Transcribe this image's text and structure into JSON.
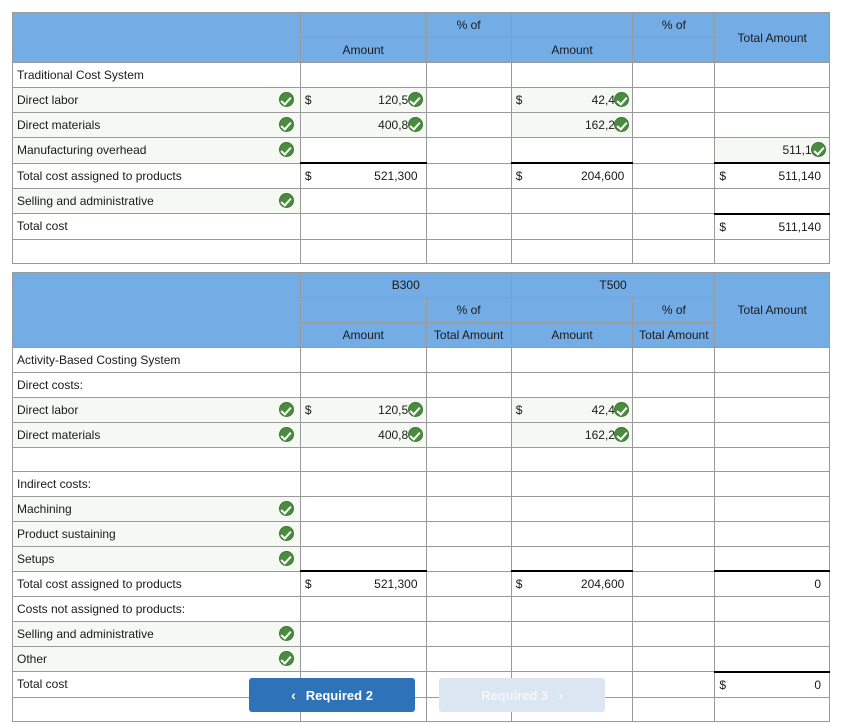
{
  "table1": {
    "header_rows": [
      [
        "",
        "",
        "% of",
        "",
        "% of",
        "Total Amount"
      ],
      [
        "",
        "Amount",
        "",
        "Amount",
        "",
        ""
      ]
    ],
    "rows": [
      {
        "label": "Traditional Cost System",
        "indent": false,
        "label_check": false,
        "cells": [
          {
            "v": ""
          },
          {
            "v": ""
          },
          {
            "v": ""
          },
          {
            "v": ""
          },
          {
            "v": ""
          }
        ]
      },
      {
        "label": "Direct labor",
        "indent": false,
        "label_check": true,
        "cells": [
          {
            "v": "120,500",
            "dollar": true,
            "check": true
          },
          {
            "v": ""
          },
          {
            "v": "42,400",
            "dollar": true,
            "check": true
          },
          {
            "v": ""
          },
          {
            "v": ""
          }
        ]
      },
      {
        "label": "Direct materials",
        "indent": false,
        "label_check": true,
        "cells": [
          {
            "v": "400,800",
            "check": true
          },
          {
            "v": ""
          },
          {
            "v": "162,200",
            "check": true
          },
          {
            "v": ""
          },
          {
            "v": ""
          }
        ]
      },
      {
        "label": "Manufacturing overhead",
        "indent": false,
        "label_check": true,
        "cells": [
          {
            "v": ""
          },
          {
            "v": ""
          },
          {
            "v": ""
          },
          {
            "v": ""
          },
          {
            "v": "511,140",
            "check": true
          }
        ]
      },
      {
        "label": "Total cost assigned to products",
        "indent": false,
        "label_check": false,
        "cells": [
          {
            "v": "521,300",
            "dollar": true,
            "rule": "total"
          },
          {
            "v": ""
          },
          {
            "v": "204,600",
            "dollar": true,
            "rule": "total"
          },
          {
            "v": ""
          },
          {
            "v": "511,140",
            "dollar": true,
            "rule": "total"
          }
        ]
      },
      {
        "label": "Selling and administrative",
        "indent": false,
        "label_check": true,
        "cells": [
          {
            "v": ""
          },
          {
            "v": ""
          },
          {
            "v": ""
          },
          {
            "v": ""
          },
          {
            "v": ""
          }
        ]
      },
      {
        "label": "Total cost",
        "indent": false,
        "label_check": false,
        "cells": [
          {
            "v": ""
          },
          {
            "v": ""
          },
          {
            "v": ""
          },
          {
            "v": ""
          },
          {
            "v": "511,140",
            "dollar": true,
            "rule": "grand"
          }
        ]
      }
    ]
  },
  "table2": {
    "header_rows": [
      [
        "",
        "B300",
        "",
        "T500",
        "",
        "Total Amount"
      ],
      [
        "",
        "",
        "% of",
        "",
        "% of",
        ""
      ],
      [
        "",
        "Amount",
        "Total Amount",
        "Amount",
        "Total Amount",
        ""
      ]
    ],
    "rows": [
      {
        "label": "Activity-Based Costing System",
        "indent": false,
        "label_check": false,
        "cells": [
          {
            "v": ""
          },
          {
            "v": ""
          },
          {
            "v": ""
          },
          {
            "v": ""
          },
          {
            "v": ""
          }
        ]
      },
      {
        "label": "Direct costs:",
        "indent": false,
        "label_check": false,
        "cells": [
          {
            "v": ""
          },
          {
            "v": ""
          },
          {
            "v": ""
          },
          {
            "v": ""
          },
          {
            "v": ""
          }
        ]
      },
      {
        "label": "Direct labor",
        "indent": true,
        "label_check": true,
        "cells": [
          {
            "v": "120,500",
            "dollar": true,
            "check": true
          },
          {
            "v": ""
          },
          {
            "v": "42,400",
            "dollar": true,
            "check": true
          },
          {
            "v": ""
          },
          {
            "v": ""
          }
        ]
      },
      {
        "label": "Direct materials",
        "indent": true,
        "label_check": true,
        "cells": [
          {
            "v": "400,800",
            "check": true
          },
          {
            "v": ""
          },
          {
            "v": "162,200",
            "check": true
          },
          {
            "v": ""
          },
          {
            "v": ""
          }
        ]
      },
      {
        "label": "",
        "indent": false,
        "label_check": false,
        "cells": [
          {
            "v": ""
          },
          {
            "v": ""
          },
          {
            "v": ""
          },
          {
            "v": ""
          },
          {
            "v": ""
          }
        ]
      },
      {
        "label": "Indirect costs:",
        "indent": false,
        "label_check": false,
        "cells": [
          {
            "v": ""
          },
          {
            "v": ""
          },
          {
            "v": ""
          },
          {
            "v": ""
          },
          {
            "v": ""
          }
        ]
      },
      {
        "label": "Machining",
        "indent": true,
        "label_check": true,
        "cells": [
          {
            "v": ""
          },
          {
            "v": ""
          },
          {
            "v": ""
          },
          {
            "v": ""
          },
          {
            "v": ""
          }
        ]
      },
      {
        "label": "Product sustaining",
        "indent": true,
        "label_check": true,
        "cells": [
          {
            "v": ""
          },
          {
            "v": ""
          },
          {
            "v": ""
          },
          {
            "v": ""
          },
          {
            "v": ""
          }
        ]
      },
      {
        "label": "Setups",
        "indent": true,
        "label_check": true,
        "cells": [
          {
            "v": ""
          },
          {
            "v": ""
          },
          {
            "v": ""
          },
          {
            "v": ""
          },
          {
            "v": ""
          }
        ]
      },
      {
        "label": "Total cost assigned to products",
        "indent": false,
        "label_check": false,
        "cells": [
          {
            "v": "521,300",
            "dollar": true,
            "rule": "total"
          },
          {
            "v": ""
          },
          {
            "v": "204,600",
            "dollar": true,
            "rule": "total"
          },
          {
            "v": ""
          },
          {
            "v": "0",
            "rule": "total"
          }
        ]
      },
      {
        "label": "Costs not assigned to products:",
        "indent": false,
        "label_check": false,
        "cells": [
          {
            "v": ""
          },
          {
            "v": ""
          },
          {
            "v": ""
          },
          {
            "v": ""
          },
          {
            "v": ""
          }
        ]
      },
      {
        "label": "Selling and administrative",
        "indent": true,
        "label_check": true,
        "cells": [
          {
            "v": ""
          },
          {
            "v": ""
          },
          {
            "v": ""
          },
          {
            "v": ""
          },
          {
            "v": ""
          }
        ]
      },
      {
        "label": "Other",
        "indent": true,
        "label_check": true,
        "cells": [
          {
            "v": ""
          },
          {
            "v": ""
          },
          {
            "v": ""
          },
          {
            "v": ""
          },
          {
            "v": ""
          }
        ]
      },
      {
        "label": "Total cost",
        "indent": false,
        "label_check": false,
        "cells": [
          {
            "v": ""
          },
          {
            "v": ""
          },
          {
            "v": ""
          },
          {
            "v": ""
          },
          {
            "v": "0",
            "dollar": true,
            "rule": "grand"
          }
        ]
      }
    ]
  },
  "footer": {
    "prev_label": "Required 2",
    "prev_icon": "chevron-left-icon",
    "next_label": "Required 3",
    "next_icon": "chevron-right-icon",
    "prev_caret": "‹",
    "next_caret": "›"
  },
  "colors": {
    "header_blue": "#74ace6",
    "active_button": "#2e72b8",
    "disabled_button": "#dce6f2",
    "check_green": "#4a8c3f",
    "check_row_tint": "#f6f8f3",
    "grid_border": "#9a9a9a"
  }
}
